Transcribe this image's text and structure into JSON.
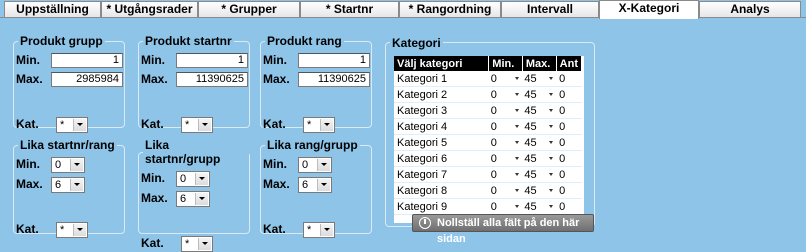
{
  "tabs": [
    {
      "label": "Uppställning"
    },
    {
      "label": "* Utgångsrader"
    },
    {
      "label": "* Grupper"
    },
    {
      "label": "* Startnr"
    },
    {
      "label": "* Rangordning"
    },
    {
      "label": "Intervall"
    },
    {
      "label": "X-Kategori",
      "active": true
    },
    {
      "label": "Analys"
    }
  ],
  "groups": {
    "produkt_grupp": {
      "title": "Produkt grupp",
      "min_label": "Min.",
      "min_value": "1",
      "max_label": "Max.",
      "max_value": "2985984",
      "kat_label": "Kat.",
      "kat_value": "*"
    },
    "produkt_startnr": {
      "title": "Produkt startnr",
      "min_label": "Min.",
      "min_value": "1",
      "max_label": "Max.",
      "max_value": "11390625",
      "kat_label": "Kat.",
      "kat_value": "*"
    },
    "produkt_rang": {
      "title": "Produkt rang",
      "min_label": "Min.",
      "min_value": "1",
      "max_label": "Max.",
      "max_value": "11390625",
      "kat_label": "Kat.",
      "kat_value": "*"
    },
    "lika_startnr_rang": {
      "title": "Lika startnr/rang",
      "min_label": "Min.",
      "min_value": "0",
      "max_label": "Max.",
      "max_value": "6",
      "kat_label": "Kat.",
      "kat_value": "*"
    },
    "lika_startnr_grupp": {
      "title": "Lika startnr/grupp",
      "min_label": "Min.",
      "min_value": "0",
      "max_label": "Max.",
      "max_value": "6",
      "kat_label": "Kat.",
      "kat_value": "*"
    },
    "lika_rang_grupp": {
      "title": "Lika rang/grupp",
      "min_label": "Min.",
      "min_value": "0",
      "max_label": "Max.",
      "max_value": "6",
      "kat_label": "Kat.",
      "kat_value": "*"
    }
  },
  "kategori": {
    "title": "Kategori",
    "headers": {
      "name": "Välj kategori",
      "min": "Min.",
      "max": "Max.",
      "ant": "Ant"
    },
    "rows": [
      {
        "name": "Kategori 1",
        "min": "0",
        "max": "45",
        "ant": "0"
      },
      {
        "name": "Kategori 2",
        "min": "0",
        "max": "45",
        "ant": "0"
      },
      {
        "name": "Kategori 3",
        "min": "0",
        "max": "45",
        "ant": "0"
      },
      {
        "name": "Kategori 4",
        "min": "0",
        "max": "45",
        "ant": "0"
      },
      {
        "name": "Kategori 5",
        "min": "0",
        "max": "45",
        "ant": "0"
      },
      {
        "name": "Kategori 6",
        "min": "0",
        "max": "45",
        "ant": "0"
      },
      {
        "name": "Kategori 7",
        "min": "0",
        "max": "45",
        "ant": "0"
      },
      {
        "name": "Kategori 8",
        "min": "0",
        "max": "45",
        "ant": "0"
      },
      {
        "name": "Kategori 9",
        "min": "0",
        "max": "45",
        "ant": "0"
      }
    ]
  },
  "reset_button": {
    "label": "Nollställ alla fält på den här sidan",
    "icon": "power-icon"
  }
}
